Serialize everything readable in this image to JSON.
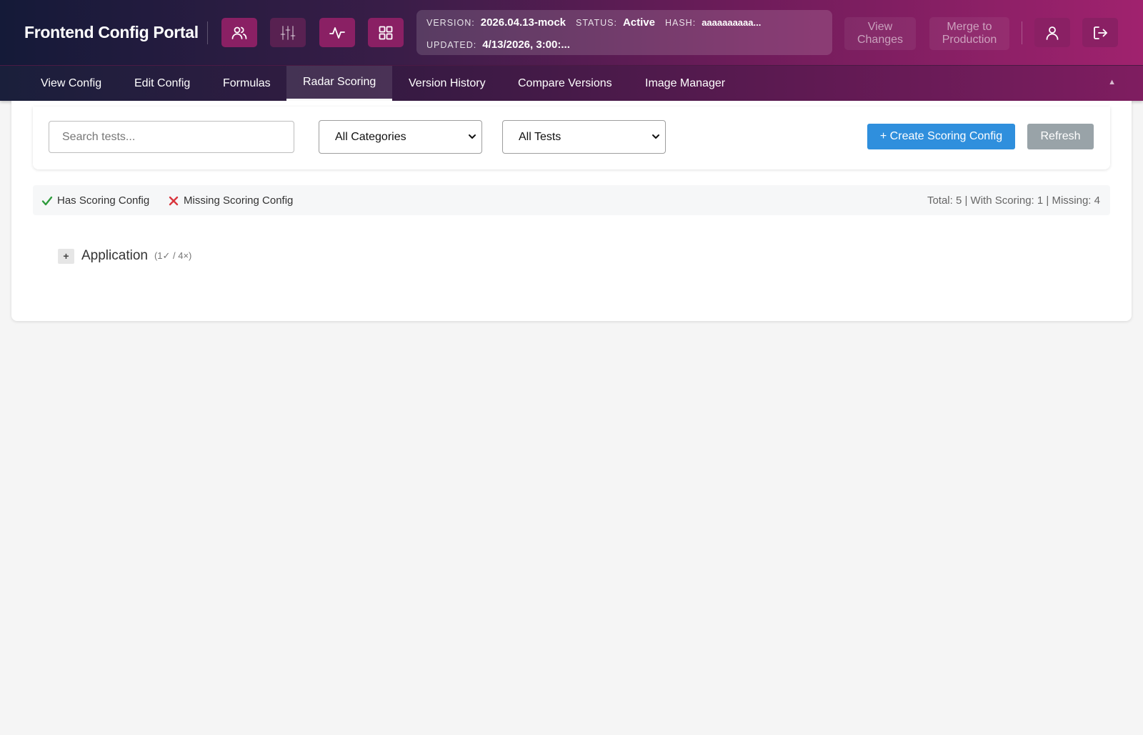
{
  "app": {
    "title": "Frontend Config Portal"
  },
  "header": {
    "icon_buttons": [
      "users-icon",
      "sliders-icon",
      "activity-icon",
      "grid-icon"
    ],
    "info": {
      "version_label": "VERSION:",
      "version": "2026.04.13-mock",
      "status_label": "STATUS:",
      "status": "Active",
      "hash_label": "HASH:",
      "hash": "aaaaaaaaaa...",
      "updated_label": "UPDATED:",
      "updated": "4/13/2026, 3:00:..."
    },
    "view_changes_line1": "View",
    "view_changes_line2": "Changes",
    "merge_line1": "Merge to",
    "merge_line2": "Production",
    "colors": {
      "accent": "#8a2064",
      "gradient_start": "#141a38",
      "gradient_end": "#a0226e"
    }
  },
  "tabs": [
    {
      "label": "View Config"
    },
    {
      "label": "Edit Config"
    },
    {
      "label": "Formulas"
    },
    {
      "label": "Radar Scoring",
      "active": true
    },
    {
      "label": "Version History"
    },
    {
      "label": "Compare Versions"
    },
    {
      "label": "Image Manager"
    }
  ],
  "tab_collapse": "▲",
  "filters": {
    "search_placeholder": "Search tests...",
    "search_value": "",
    "category_selected": "All Categories",
    "tests_selected": "All Tests",
    "create_label": "+ Create Scoring Config",
    "refresh_label": "Refresh",
    "colors": {
      "create": "#2f8fdd",
      "refresh": "#99a3a8"
    }
  },
  "legend": {
    "has": "Has Scoring Config",
    "missing": "Missing Scoring Config",
    "totals": "Total: 5 | With Scoring: 1 | Missing: 4",
    "colors": {
      "has": "#2e9b3c",
      "missing": "#d9363e"
    }
  },
  "groups": [
    {
      "expand_glyph": "+",
      "name": "Application",
      "count": "(1✓ / 4×)"
    }
  ]
}
